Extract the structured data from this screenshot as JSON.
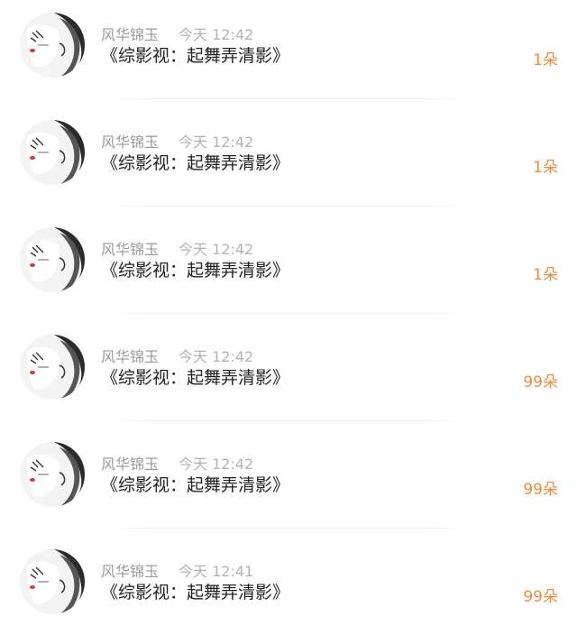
{
  "gifts": [
    {
      "user": "风华锦玉",
      "time": "今天 12:42",
      "book": "《综影视：起舞弄清影》",
      "count": "1朵"
    },
    {
      "user": "风华锦玉",
      "time": "今天 12:42",
      "book": "《综影视：起舞弄清影》",
      "count": "1朵"
    },
    {
      "user": "风华锦玉",
      "time": "今天 12:42",
      "book": "《综影视：起舞弄清影》",
      "count": "1朵"
    },
    {
      "user": "风华锦玉",
      "time": "今天 12:42",
      "book": "《综影视：起舞弄清影》",
      "count": "99朵"
    },
    {
      "user": "风华锦玉",
      "time": "今天 12:42",
      "book": "《综影视：起舞弄清影》",
      "count": "99朵"
    },
    {
      "user": "风华锦玉",
      "time": "今天 12:41",
      "book": "《综影视：起舞弄清影》",
      "count": "99朵"
    }
  ],
  "colors": {
    "count": "#f08c3a",
    "username": "#999999",
    "time": "#b3b3b3",
    "title": "#222222"
  },
  "icons": {
    "avatar": "user-avatar-portrait"
  }
}
